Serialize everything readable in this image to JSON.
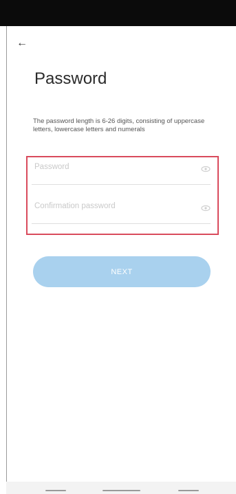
{
  "header": {
    "back_icon": "arrow-left-icon",
    "back_glyph": "←"
  },
  "page": {
    "title": "Password",
    "description": "The password length is 6-26 digits, consisting of uppercase letters, lowercase letters and numerals"
  },
  "form": {
    "password": {
      "placeholder": "Password",
      "value": "",
      "icon": "eye-icon"
    },
    "confirm_password": {
      "placeholder": "Confirmation password",
      "value": "",
      "icon": "eye-icon"
    },
    "next_label": "NEXT"
  },
  "colors": {
    "status_bar": "#0b0b0b",
    "button_disabled": "#a9d1ee",
    "highlight": "#d94a5c",
    "placeholder": "#c9c9c9"
  },
  "navigation": {
    "buttons": [
      "recent-apps",
      "home",
      "back"
    ]
  }
}
